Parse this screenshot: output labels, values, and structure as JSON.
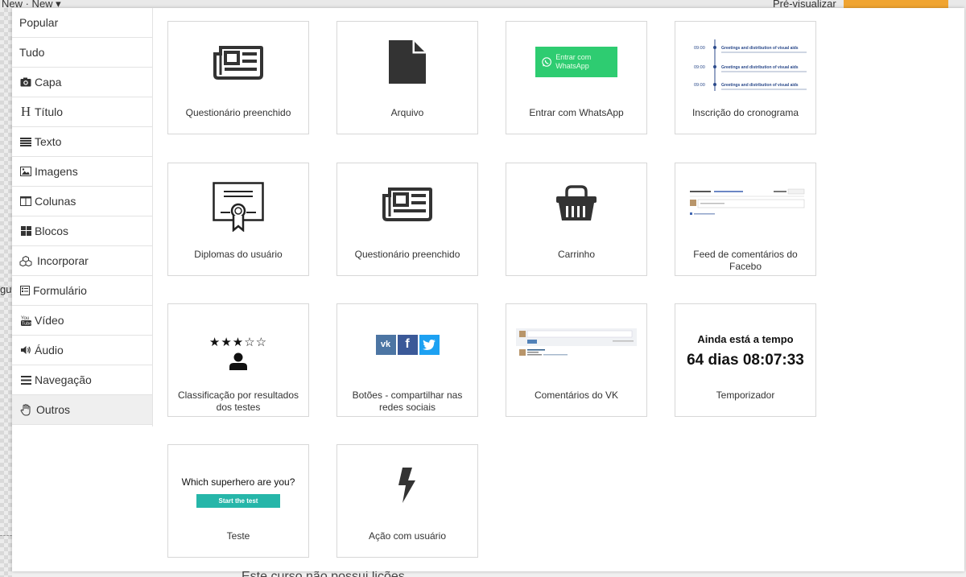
{
  "background": {
    "top_left": "New  · New ▾",
    "top_right": "Pré-visualizar",
    "left_fragment": "gu",
    "bottom_text": "Este curso não possui lições"
  },
  "sidebar": {
    "items": [
      {
        "label": "Popular",
        "icon": ""
      },
      {
        "label": "Tudo",
        "icon": ""
      },
      {
        "label": "Capa",
        "icon": "camera-icon"
      },
      {
        "label": "Título",
        "icon": "heading-icon"
      },
      {
        "label": "Texto",
        "icon": "text-lines-icon"
      },
      {
        "label": "Imagens",
        "icon": "image-icon"
      },
      {
        "label": "Colunas",
        "icon": "columns-icon"
      },
      {
        "label": "Blocos",
        "icon": "blocks-icon"
      },
      {
        "label": "Incorporar",
        "icon": "cubes-icon"
      },
      {
        "label": "Formulário",
        "icon": "form-icon"
      },
      {
        "label": "Vídeo",
        "icon": "youtube-icon"
      },
      {
        "label": "Áudio",
        "icon": "volume-icon"
      },
      {
        "label": "Navegação",
        "icon": "menu-icon"
      },
      {
        "label": "Outros",
        "icon": "hand-icon"
      }
    ],
    "active": "Outros"
  },
  "cards": [
    {
      "label": "Questionário preenchido",
      "thumb": "newspaper-icon"
    },
    {
      "label": "Arquivo",
      "thumb": "file-icon"
    },
    {
      "label": "Entrar com WhatsApp",
      "thumb": "whatsapp-button",
      "button_text": "Entrar com WhatsApp"
    },
    {
      "label": "Inscrição do cronograma",
      "thumb": "schedule-preview",
      "schedule": [
        {
          "time": "09:00",
          "title": "Greetings and distribution of visual aids"
        },
        {
          "time": "09:00",
          "title": "Greetings and distribution of visual aids"
        },
        {
          "time": "09:00",
          "title": "Greetings and distribution of visual aids"
        }
      ]
    },
    {
      "label": "Diplomas do usuário",
      "thumb": "certificate-icon"
    },
    {
      "label": "Questionário preenchido",
      "thumb": "newspaper-icon"
    },
    {
      "label": "Carrinho",
      "thumb": "basket-icon"
    },
    {
      "label": "Feed de comentários do Facebo",
      "thumb": "facebook-comments-preview"
    },
    {
      "label": "Classificação por resultados dos testes",
      "thumb": "rating-preview",
      "stars": "★★★☆☆"
    },
    {
      "label": "Botões - compartilhar nas redes sociais",
      "thumb": "social-buttons",
      "social": [
        "vk",
        "f",
        "t"
      ]
    },
    {
      "label": "Comentários do VK",
      "thumb": "vk-comments-preview"
    },
    {
      "label": "Temporizador",
      "thumb": "timer-preview",
      "timer_title": "Ainda está a tempo",
      "timer_value": "64 dias 08:07:33"
    },
    {
      "label": "Teste",
      "thumb": "quiz-preview",
      "quiz_title": "Which superhero are you?",
      "quiz_button": "Start the test"
    },
    {
      "label": "Ação com usuário",
      "thumb": "lightning-icon"
    }
  ],
  "colors": {
    "whatsapp": "#2ecc71",
    "quiz_button": "#26b6a9",
    "vk": "#4c75a3",
    "facebook": "#3b5998",
    "twitter": "#1da1f2",
    "icon_dark": "#333333"
  }
}
